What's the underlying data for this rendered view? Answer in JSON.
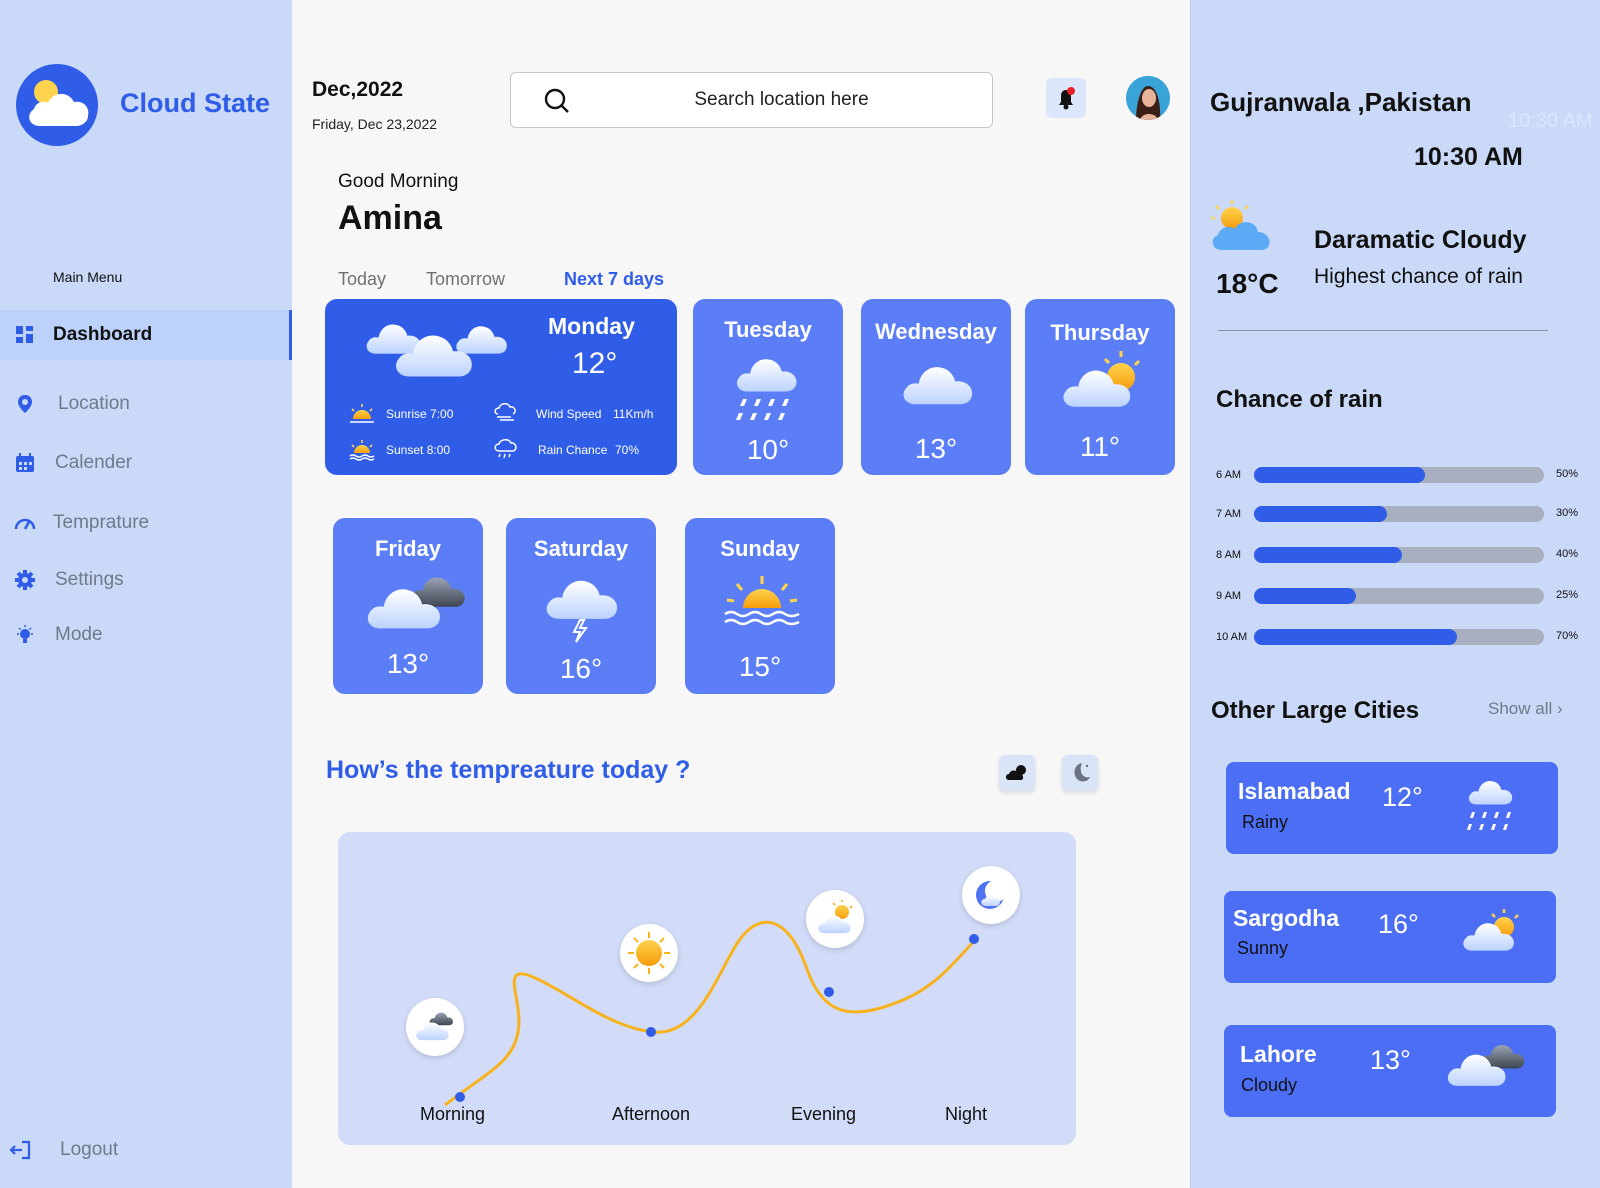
{
  "sidebar": {
    "brand": "Cloud State",
    "menu_title": "Main Menu",
    "items": [
      {
        "label": "Dashboard",
        "icon": "grid-icon"
      },
      {
        "label": "Location",
        "icon": "location-pin-icon"
      },
      {
        "label": "Calender",
        "icon": "calendar-icon"
      },
      {
        "label": "Temprature",
        "icon": "speedometer-icon"
      },
      {
        "label": "Settings",
        "icon": "gear-icon"
      },
      {
        "label": "Mode",
        "icon": "lightbulb-icon"
      }
    ],
    "logout": "Logout"
  },
  "header": {
    "month": "Dec,2022",
    "date": "Friday, Dec 23,2022",
    "search_placeholder": "Search location here"
  },
  "greeting": {
    "text": "Good Morning",
    "name": "Amina"
  },
  "tabs": [
    "Today",
    "Tomorrow",
    "Next 7 days"
  ],
  "forecast": {
    "monday": {
      "day": "Monday",
      "temp": "12°",
      "sunrise": "Sunrise 7:00",
      "sunset": "Sunset  8:00",
      "wind_label": "Wind Speed",
      "wind_value": "11Km/h",
      "rain_label": "Rain Chance",
      "rain_value": "70%"
    },
    "days": [
      {
        "day": "Tuesday",
        "temp": "10°",
        "icon": "rain-cloud-icon"
      },
      {
        "day": "Wednesday",
        "temp": "13°",
        "icon": "cloud-icon"
      },
      {
        "day": "Thursday",
        "temp": "11°",
        "icon": "sun-cloud-icon"
      },
      {
        "day": "Friday",
        "temp": "13°",
        "icon": "dark-cloud-icon"
      },
      {
        "day": "Saturday",
        "temp": "16°",
        "icon": "thunder-cloud-icon"
      },
      {
        "day": "Sunday",
        "temp": "15°",
        "icon": "sunset-icon"
      }
    ]
  },
  "chart": {
    "title": "How’s the tempreature today ?",
    "periods": [
      "Morning",
      "Afternoon",
      "Evening",
      "Night"
    ]
  },
  "right": {
    "city": "Gujranwala ,Pakistan",
    "ghost_time": "10:30 AM",
    "time": "10:30 AM",
    "temp": "18°C",
    "condition": "Daramatic Cloudy",
    "condition_sub": "Highest chance of rain",
    "rain_title": "Chance of rain",
    "rain": [
      {
        "time": "6 AM",
        "label": "50%",
        "value": 0.59
      },
      {
        "time": "7 AM",
        "label": "30%",
        "value": 0.46
      },
      {
        "time": "8 AM",
        "label": "40%",
        "value": 0.51
      },
      {
        "time": "9 AM",
        "label": "25%",
        "value": 0.35
      },
      {
        "time": "10 AM",
        "label": "70%",
        "value": 0.7
      }
    ],
    "others_title": "Other Large Cities",
    "show_all": "Show all",
    "cities": [
      {
        "name": "Islamabad",
        "condition": "Rainy",
        "temp": "12°"
      },
      {
        "name": "Sargodha",
        "condition": "Sunny",
        "temp": "16°"
      },
      {
        "name": "Lahore",
        "condition": "Cloudy",
        "temp": "13°"
      }
    ]
  },
  "colors": {
    "accent": "#2f5de8",
    "card": "#5b7ef7",
    "sidebar": "#c9d9f7",
    "sun": "#f7b21c"
  }
}
